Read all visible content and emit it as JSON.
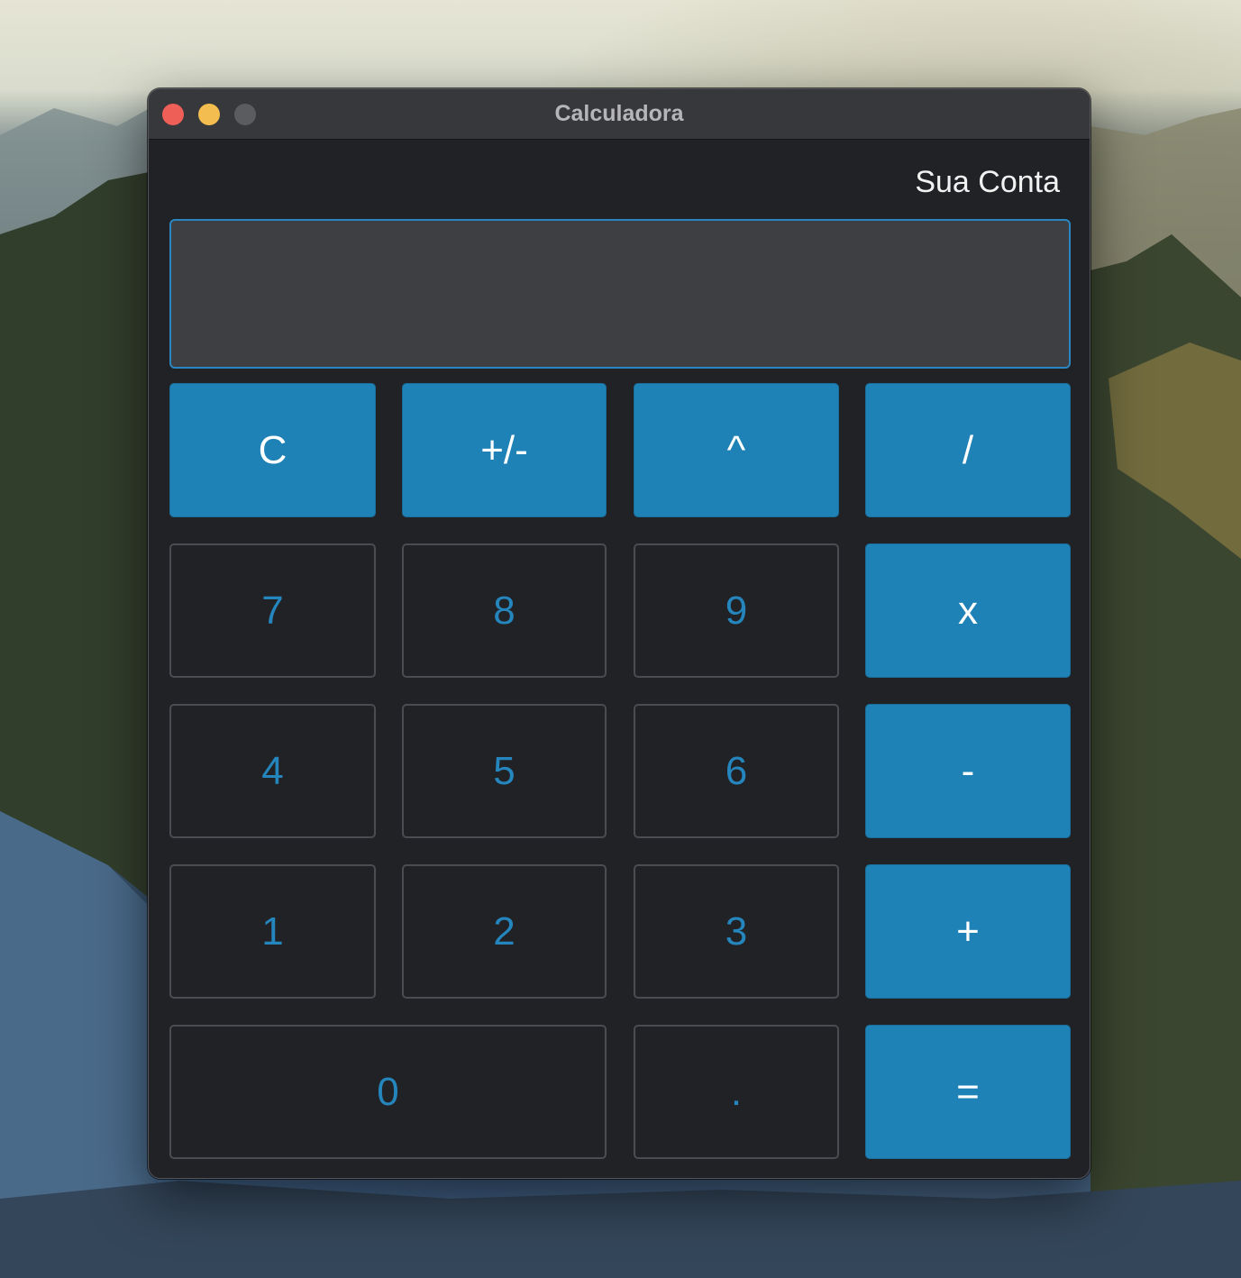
{
  "window": {
    "title": "Calculadora"
  },
  "account": {
    "label": "Sua Conta"
  },
  "display": {
    "value": ""
  },
  "keys": {
    "clear": "C",
    "negate": "+/-",
    "power": "^",
    "divide": "/",
    "seven": "7",
    "eight": "8",
    "nine": "9",
    "multiply": "x",
    "four": "4",
    "five": "5",
    "six": "6",
    "subtract": "-",
    "one": "1",
    "two": "2",
    "three": "3",
    "add": "+",
    "zero": "0",
    "decimal": ".",
    "equals": "="
  },
  "colors": {
    "accent": "#1f82b6",
    "digit_text": "#2585bd",
    "window_bg": "#212226",
    "titlebar_bg": "#37383c",
    "close_button": "#ee5f57",
    "minimize_button": "#f4bd4f",
    "zoom_button_disabled": "#5b5c60"
  }
}
